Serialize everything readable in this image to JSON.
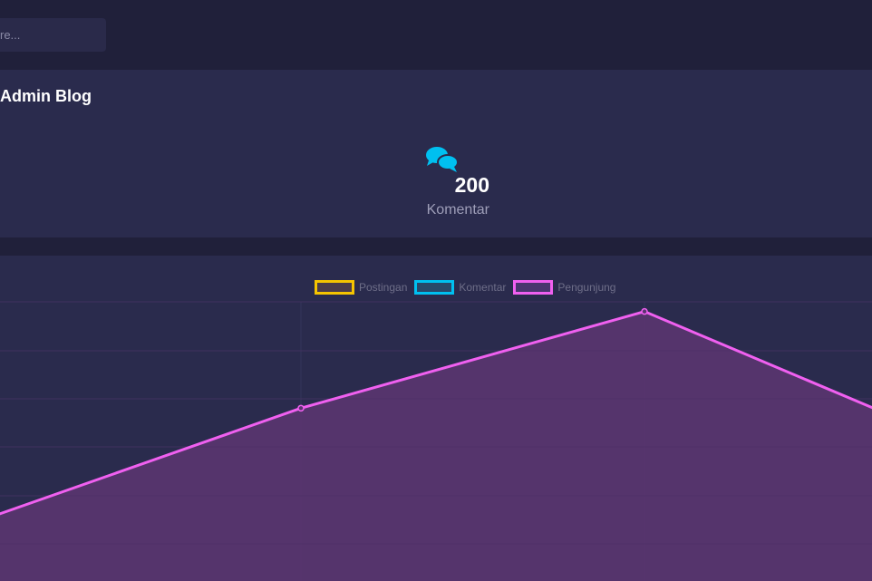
{
  "header": {
    "search_placeholder": "re..."
  },
  "card": {
    "title": "Admin Blog",
    "stat_icon": "comments-icon",
    "stat_value": "200",
    "stat_label": "Komentar"
  },
  "colors": {
    "postingan": "#f5c400",
    "komentar": "#00c0f0",
    "pengunjung": "#f060f0",
    "fill": "#5a3570"
  },
  "chart_data": {
    "type": "area",
    "legend": [
      "Postingan",
      "Komentar",
      "Pengunjung"
    ],
    "series": [
      {
        "name": "Pengunjung",
        "values": [
          13,
          38,
          58,
          28
        ]
      }
    ],
    "ylim": [
      0,
      60
    ],
    "grid": true,
    "legend_placement": "top"
  }
}
